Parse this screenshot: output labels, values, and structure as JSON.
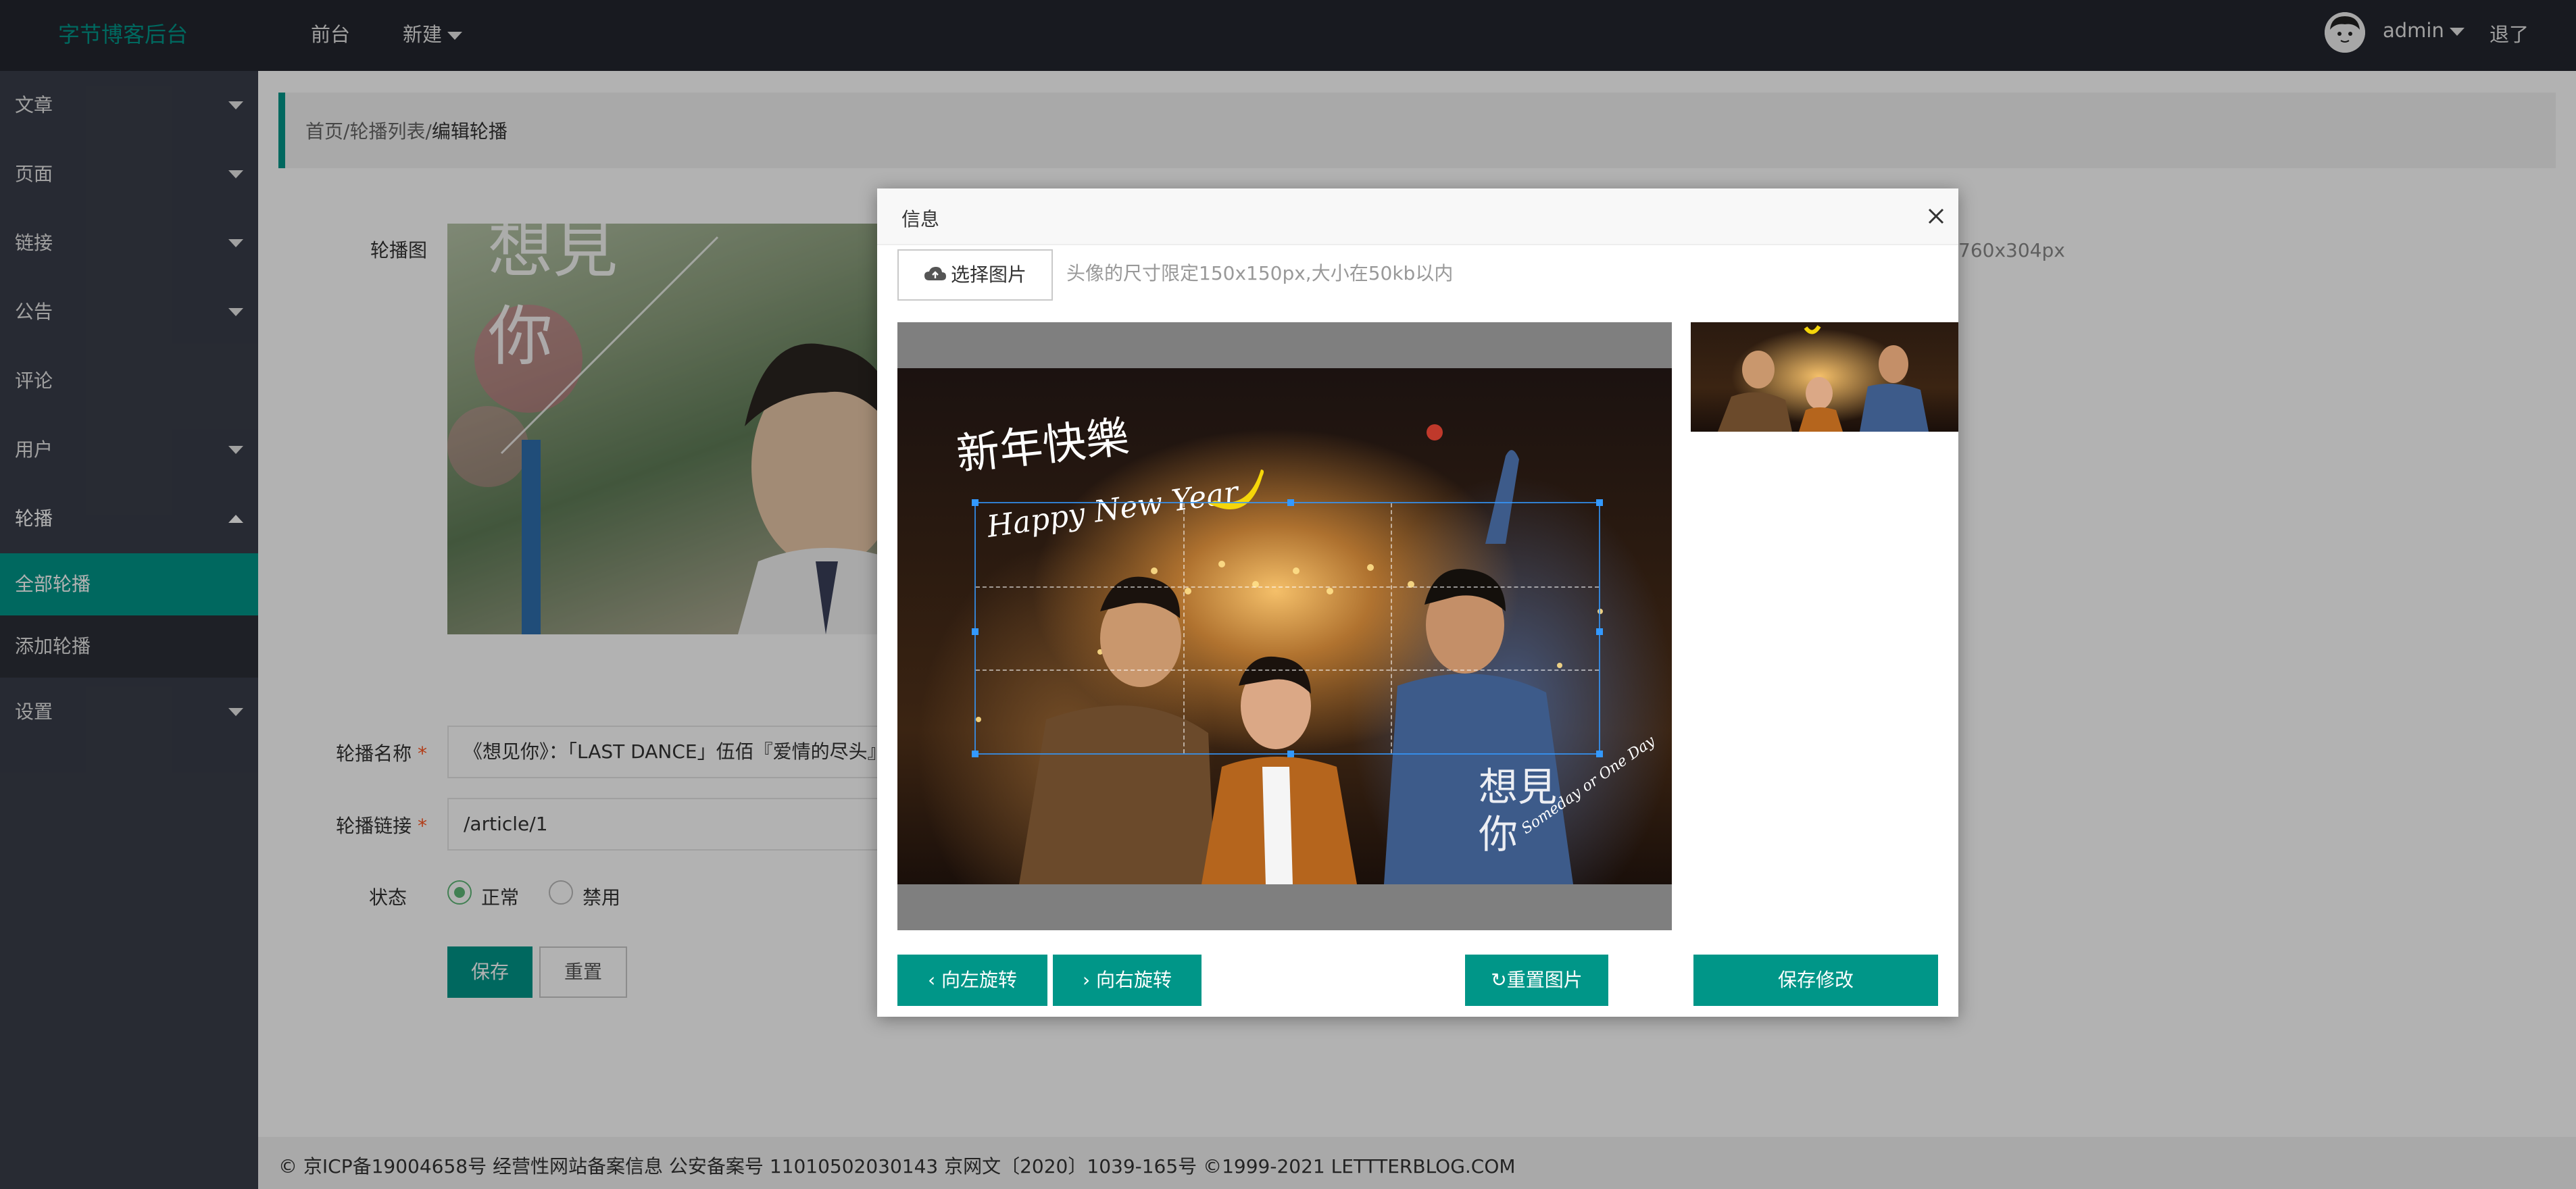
{
  "header": {
    "logo": "字节博客后台",
    "nav": {
      "front": "前台",
      "create": "新建"
    },
    "user": {
      "name": "admin",
      "logout": "退了"
    }
  },
  "sidebar": {
    "items": [
      {
        "label": "文章"
      },
      {
        "label": "页面"
      },
      {
        "label": "链接"
      },
      {
        "label": "公告"
      },
      {
        "label": "评论"
      },
      {
        "label": "用户"
      },
      {
        "label": "轮播"
      }
    ],
    "sub": [
      {
        "label": "全部轮播"
      },
      {
        "label": "添加轮播"
      }
    ],
    "settings": "设置"
  },
  "breadcrumb": {
    "home": "首页",
    "sep": "/",
    "list": "轮播列表",
    "current": "编辑轮播"
  },
  "form": {
    "image_label": "轮播图",
    "size_hint": "760x304px",
    "name_label": "轮播名称",
    "name_value": "《想见你》：「LAST DANCE」伍佰『爱情的尽头』",
    "link_label": "轮播链接",
    "link_value": "/article/1",
    "status_label": "状态",
    "status_normal": "正常",
    "status_disabled": "禁用",
    "save": "保存",
    "reset": "重置",
    "required_mark": "*"
  },
  "footer": {
    "text": "© 京ICP备19004658号 经营性网站备案信息 公安备案号 11010502030143 京网文〔2020〕1039-165号 ©1999-2021 LETTTERBLOG.COM"
  },
  "dialog": {
    "title": "信息",
    "choose_image": "选择图片",
    "hint": "头像的尺寸限定150x150px,大小在50kb以内",
    "rotate_left": "向左旋转",
    "rotate_right": "向右旋转",
    "reset_image": "重置图片",
    "save_changes": "保存修改",
    "photo_text": {
      "cn": "新年快樂",
      "en": "Happy New Year",
      "title_cn_1": "想見",
      "title_cn_2": "你",
      "script": "Someday or One Day"
    }
  },
  "colors": {
    "accent": "#009688",
    "header_bg": "#23262e",
    "sidebar_bg": "#393d49",
    "required": "#ff5722"
  }
}
